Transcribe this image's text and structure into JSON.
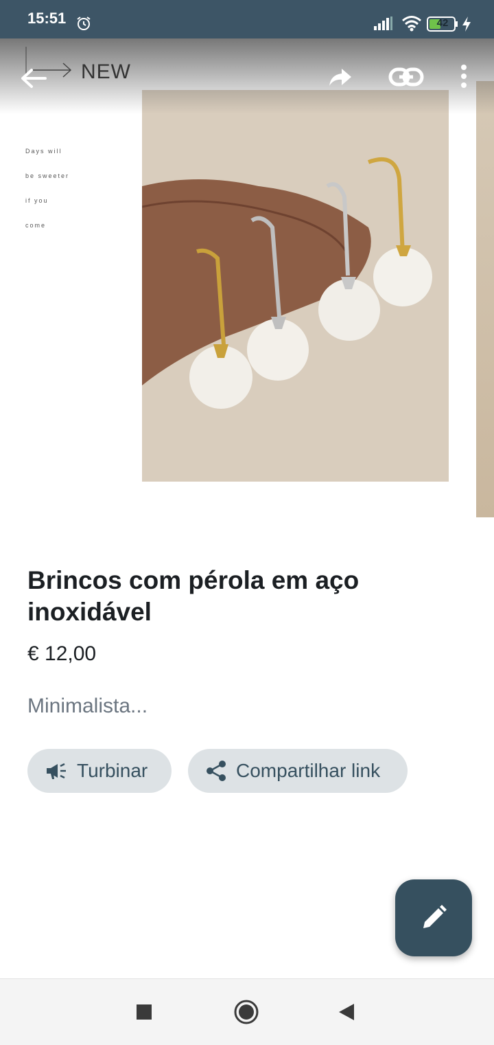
{
  "status_bar": {
    "time": "15:51",
    "battery": "42",
    "icons": [
      "alarm-icon",
      "signal-icon",
      "wifi-icon",
      "battery-icon",
      "charging-icon"
    ]
  },
  "gallery": {
    "overlay_text": "NEW",
    "poem_lines": [
      "Days will",
      "be sweeter",
      "if you",
      "come"
    ]
  },
  "toolbar": {
    "icons": [
      "back-arrow-icon",
      "forward-share-icon",
      "link-icon",
      "more-vert-icon"
    ]
  },
  "product": {
    "title": "Brincos com pérola em aço inoxidável",
    "price": "€ 12,00",
    "description": "Minimalista..."
  },
  "actions": {
    "boost_label": "Turbinar",
    "share_label": "Compartilhar link"
  },
  "fab": {
    "icon": "edit-pencil-icon"
  },
  "colors": {
    "status_bar": "#3d5566",
    "accent": "#36505f",
    "chip_bg": "#dde2e5"
  },
  "nav": {
    "icons": [
      "recents-icon",
      "home-icon",
      "back-icon"
    ]
  }
}
